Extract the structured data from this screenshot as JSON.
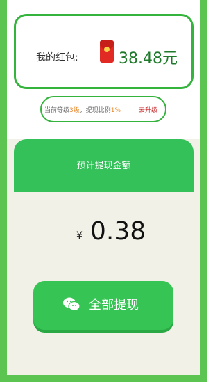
{
  "wallet": {
    "label": "我的红包:",
    "amount": "38.48元",
    "icon": "red-envelope-icon"
  },
  "level": {
    "prefix": "当前等级",
    "level_value": "3级",
    "middle": "，提现比例",
    "ratio": "1%",
    "upgrade_link": "去升级"
  },
  "estimate": {
    "header": "预计提现金额",
    "currency": "¥",
    "amount": "0.38"
  },
  "action": {
    "withdraw_label": "全部提现",
    "icon": "wechat-icon"
  },
  "colors": {
    "accent_green": "#34c15a",
    "frame_green": "#5cc552",
    "amount_green": "#1f7b2b",
    "upgrade_red": "#c62828",
    "background": "#f2f1e8"
  }
}
